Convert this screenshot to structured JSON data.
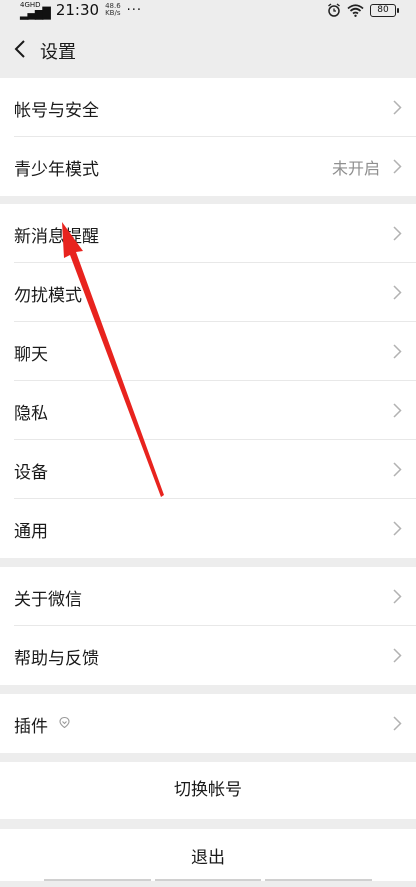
{
  "status_bar": {
    "network": "4GHD",
    "time": "21:30",
    "speed_value": "48.6",
    "speed_unit": "KB/s",
    "more": "···",
    "battery": "80"
  },
  "nav": {
    "title": "设置"
  },
  "groups": [
    {
      "rows": [
        {
          "label": "帐号与安全"
        },
        {
          "label": "青少年模式",
          "value": "未开启"
        }
      ]
    },
    {
      "rows": [
        {
          "label": "新消息提醒"
        },
        {
          "label": "勿扰模式"
        },
        {
          "label": "聊天"
        },
        {
          "label": "隐私"
        },
        {
          "label": "设备"
        },
        {
          "label": "通用"
        }
      ]
    },
    {
      "rows": [
        {
          "label": "关于微信"
        },
        {
          "label": "帮助与反馈"
        }
      ]
    },
    {
      "rows": [
        {
          "label": "插件"
        }
      ]
    }
  ],
  "buttons": {
    "switch_account": "切换帐号",
    "logout": "退出"
  },
  "colors": {
    "background": "#ededed",
    "annotation_arrow": "#e8231e",
    "secondary_text": "#8f8f8f"
  }
}
